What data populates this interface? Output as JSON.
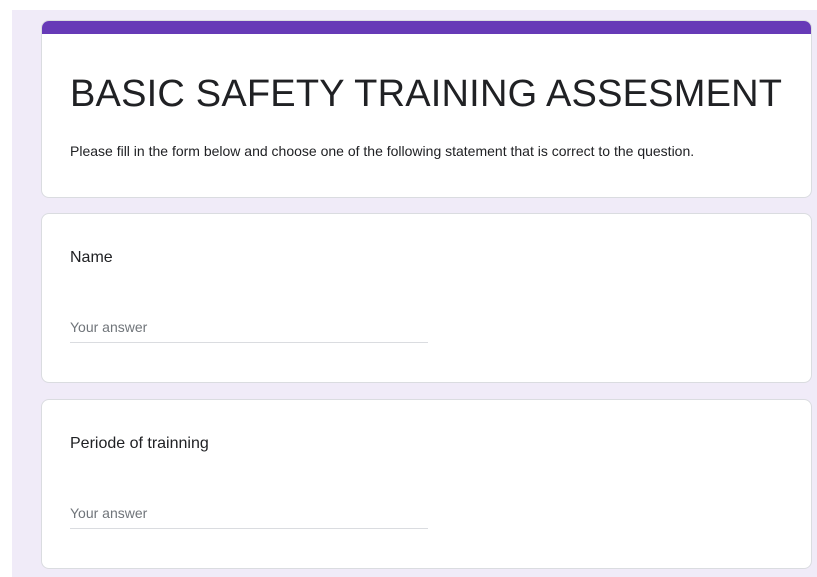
{
  "form": {
    "title": "BASIC SAFETY TRAINING ASSESMENT",
    "description": "Please fill in the form below and choose one of the following statement that is correct to the question.",
    "accent_color": "#673ab7",
    "background_color": "#f0ebf8"
  },
  "questions": [
    {
      "label": "Name",
      "placeholder": "Your answer",
      "value": ""
    },
    {
      "label": "Periode of trainning",
      "placeholder": "Your answer",
      "value": ""
    }
  ]
}
